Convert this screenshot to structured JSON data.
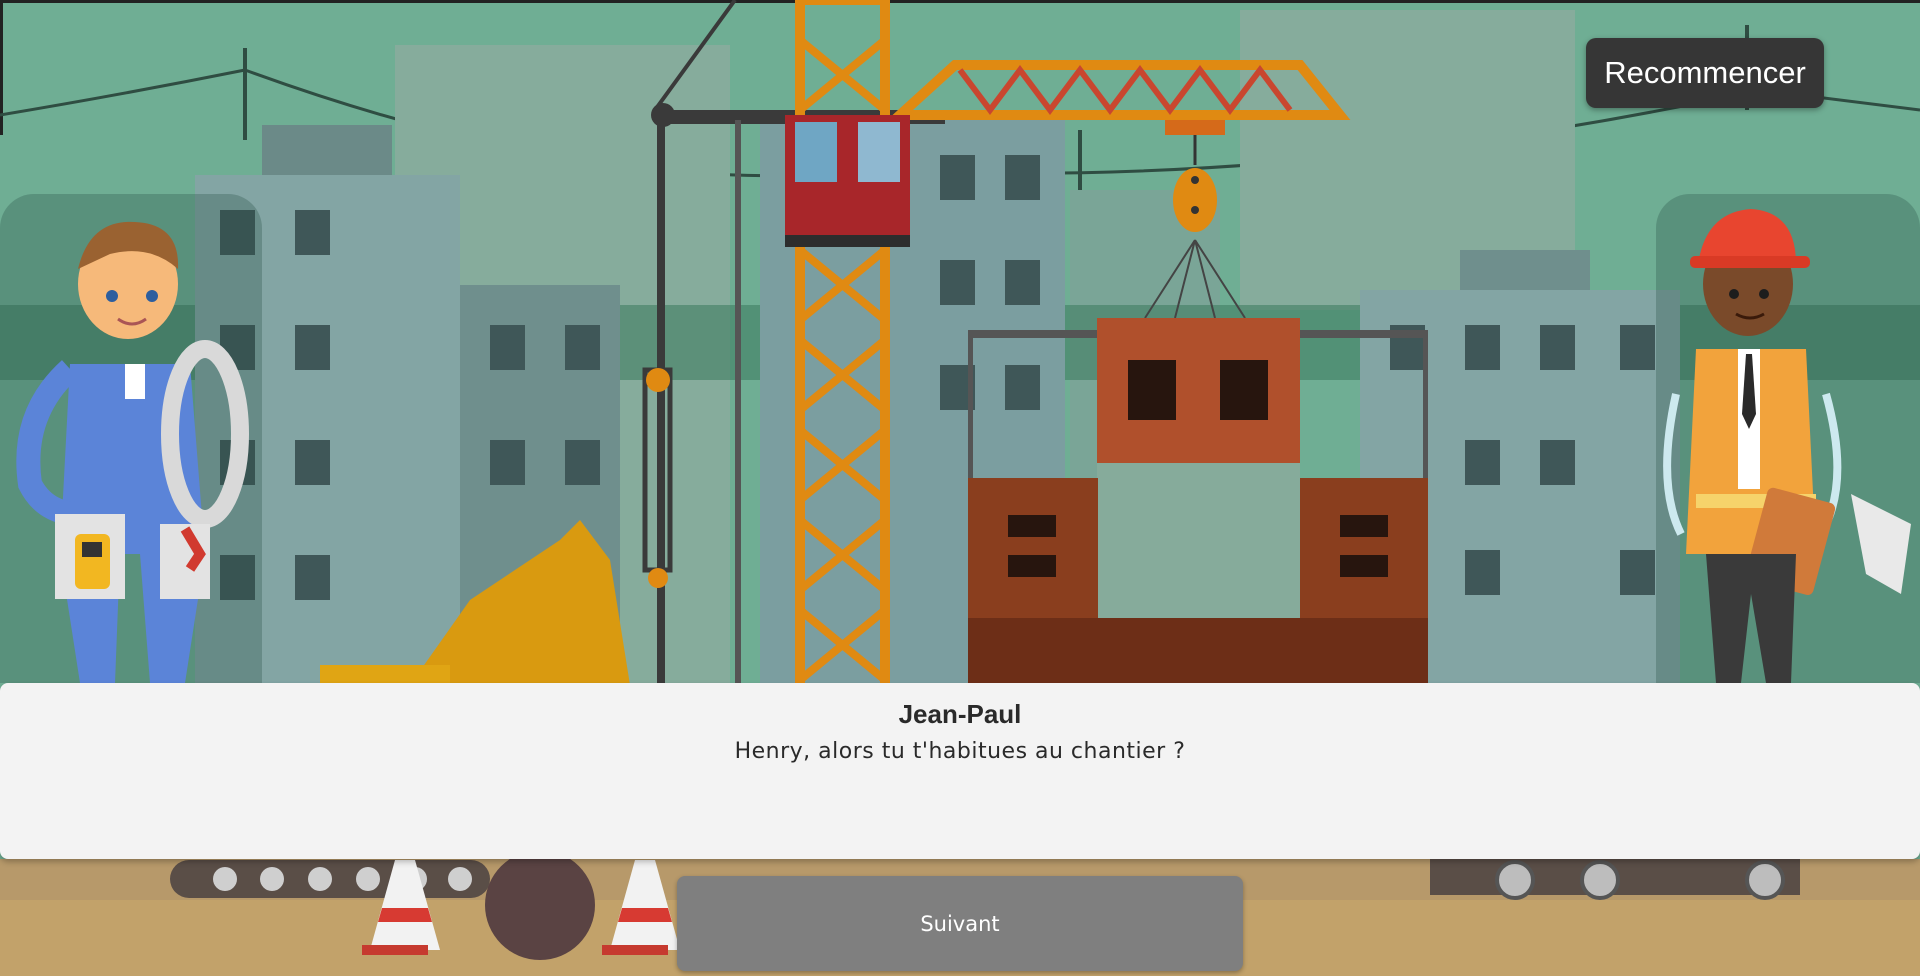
{
  "game": {
    "restart_label": "Recommencer",
    "dialog": {
      "speaker": "Jean-Paul",
      "text": "Henry, alors tu t'habitues au chantier ?"
    },
    "next_label": "Suivant"
  },
  "characters": {
    "left": {
      "icon": "electrician-character-icon",
      "role": "electrician"
    },
    "right": {
      "icon": "foreman-character-icon",
      "role": "site-manager"
    }
  },
  "colors": {
    "sky": "#6fae94",
    "crane": "#e08a12",
    "bricks": "#b0502c",
    "dialog_bg": "#f3f3f3",
    "restart_bg": "#363636",
    "next_bg": "#7f7f7f"
  }
}
